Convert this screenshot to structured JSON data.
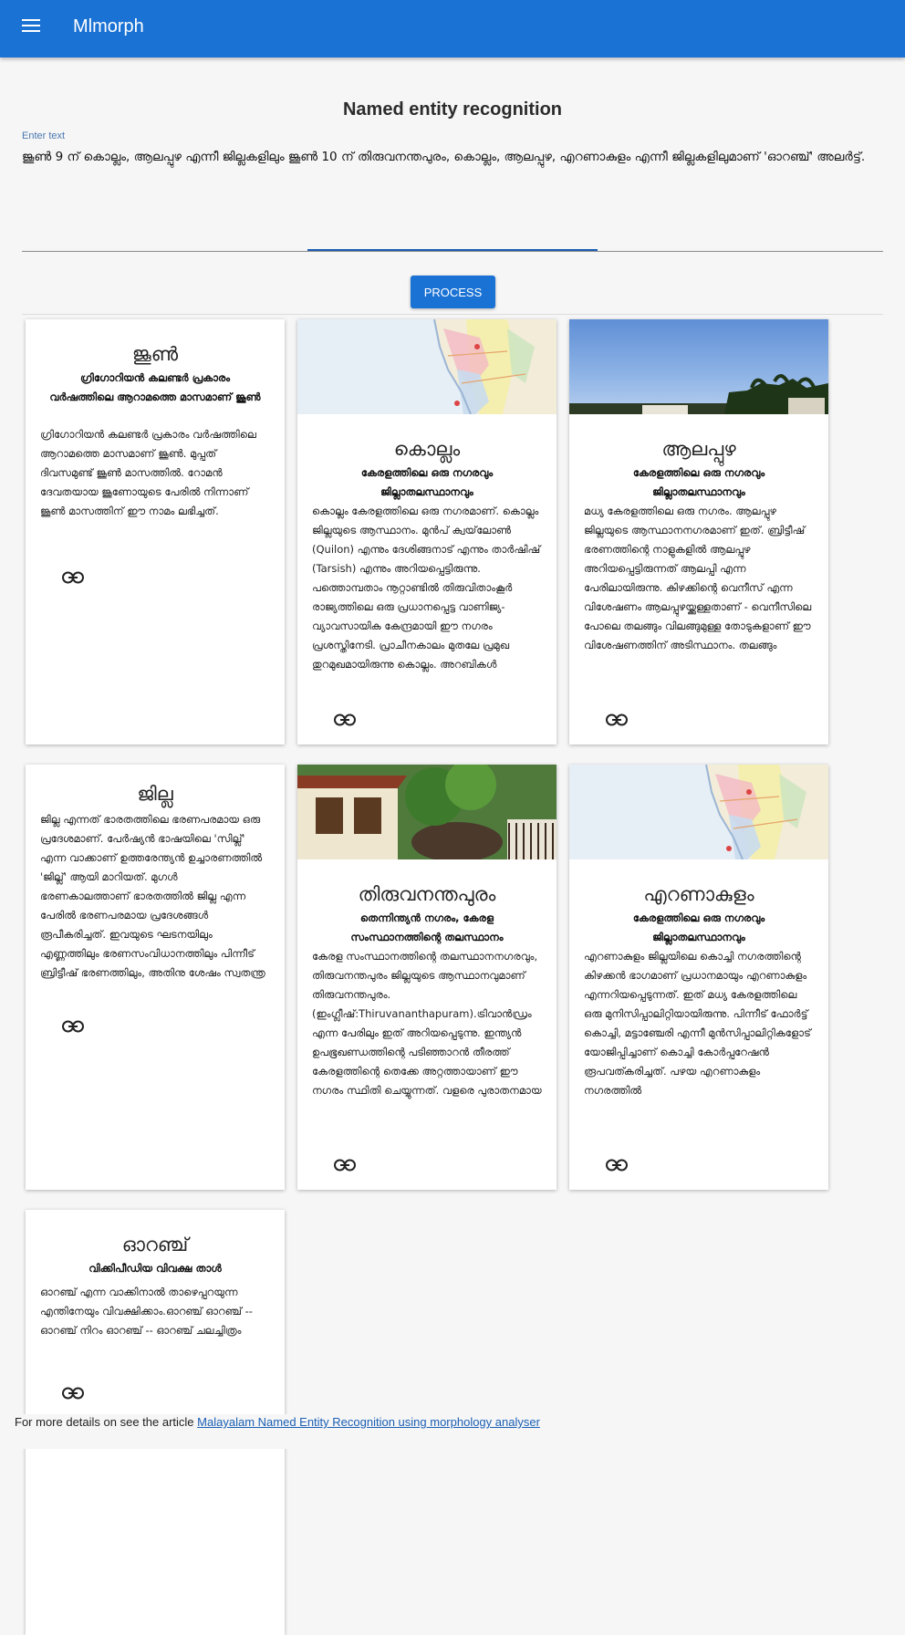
{
  "app": {
    "title": "Mlmorph"
  },
  "page": {
    "title": "Named entity recognition"
  },
  "input": {
    "label": "Enter text",
    "value": "ജൂൺ 9 ന് കൊല്ലം, ആലപ്പുഴ എന്നീ ജില്ലകളിലും ജൂൺ 10 ന് തിരുവനന്തപുരം, കൊല്ലം, ആലപ്പുഴ, എറണാകുളം എന്നീ ജില്ലകളിലുമാണ് 'ഓറഞ്ച്' അലർട്ട്."
  },
  "process_button": {
    "label": "PROCESS"
  },
  "cards": [
    {
      "word": "ജൂൺ",
      "subtitle": "ഗ്രിഗോറിയൻ കലണ്ടർ പ്രകാരം വർഷത്തിലെ ആറാമത്തെ മാസമാണ് ജൂൺ",
      "body": "ഗ്രിഗോറിയൻ കലണ്ടർ പ്രകാരം വർഷത്തിലെ ആറാമത്തെ മാസമാണ് ജൂൺ. മുപ്പത് ദിവസമുണ്ട് ജൂൺ മാസത്തിൽ. റോമൻ ദേവതയായ ജൂണോയുടെ പേരിൽ നിന്നാണ് ജൂൺ മാസത്തിന് ഈ നാമം ലഭിച്ചത്.",
      "link_icon": "link-icon"
    },
    {
      "word": "കൊല്ലം",
      "subtitle": "കേരളത്തിലെ ഒരു നഗരവും ജില്ലാതലസ്ഥാനവും",
      "body": "കൊല്ലം കേരളത്തിലെ ഒരു നഗരമാണ്. കൊല്ലം ജില്ലയുടെ ആസ്ഥാനം. മുൻപ് ക്വയ്‌ലോൺ (Quilon) എന്നും ദേശിങ്ങനാട് എന്നും താർഷിഷ് (Tarsish) എന്നും അറിയപ്പെട്ടിരുന്നു. പത്തൊമ്പതാം നൂറ്റാണ്ടിൽ തിരുവിതാംകൂർ രാജ്യത്തിലെ ഒരു പ്രധാനപ്പെട്ട വാണിജ്യ-വ്യാവസായിക കേന്ദ്രമായി ഈ നഗരം പ്രശസ്തിനേടി. പ്രാചീനകാലം മുതലേ പ്രമുഖ തുറമുഖമായിരുന്നു കൊല്ലം. അറബികൾ",
      "image": "map",
      "link_icon": "link-icon"
    },
    {
      "word": "ആലപ്പുഴ",
      "subtitle": "കേരളത്തിലെ ഒരു നഗരവും ജില്ലാതലസ്ഥാനവും",
      "body": "മധ്യ കേരളത്തിലെ ഒരു നഗരം. ആലപ്പുഴ ജില്ലയുടെ ആസ്ഥാനനഗരമാണ് ഇത്. ബ്രിട്ടീഷ് ഭരണത്തിന്റെ നാളുകളിൽ ആലപ്പുഴ അറിയപ്പെട്ടിരുന്നത് ആലപ്പി എന്ന പേരിലായിരുന്നു. കിഴക്കിന്റെ വെനീസ് എന്ന വിശേഷണം ആലപ്പുഴയ്ക്കുള്ളതാണ് - വെനീസിലെ പോലെ തലങ്ങും വിലങ്ങുമുള്ള തോടുകളാണ് ഈ വിശേഷണത്തിന് അടിസ്ഥാനം. തലങ്ങും",
      "image": "sky",
      "link_icon": "link-icon"
    },
    {
      "word": "ജില്ല",
      "subtitle": "",
      "body": "ജില്ല എന്നത് ഭാരതത്തിലെ ഭരണപരമായ ഒരു പ്രദേശമാണ്. പേർഷ്യൻ ഭാഷയിലെ 'സില്ല്' എന്ന വാക്കാണ് ഉത്തരേന്ത്യൻ ഉച്ചാരണത്തിൽ 'ജില്ല്' ആയി മാറിയത്. മുഗൾ ഭരണകാലത്താണ് ഭാരതത്തിൽ ജില്ല എന്ന പേരിൽ ഭരണപരമായ പ്രദേശങ്ങൾ രൂപീകരിച്ചത്. ഇവയുടെ ഘടനയിലും എണ്ണത്തിലും ഭരണസംവിധാനത്തിലും പിന്നീട് ബ്രിട്ടീഷ് ഭരണത്തിലും, അതിനു ശേഷം സ്വതന്ത്ര",
      "link_icon": "link-icon"
    },
    {
      "word": "തിരുവനന്തപുരം",
      "subtitle": "തെന്നിന്ത്യൻ നഗരം, കേരള സംസ്ഥാനത്തിന്റെ തലസ്ഥാനം",
      "body": "കേരള സംസ്ഥാനത്തിന്റെ തലസ്ഥാനനഗരവും, തിരുവനന്തപുരം ജില്ലയുടെ ആസ്ഥാനവുമാണ് തിരുവനന്തപുരം. (ഇംഗ്ലീഷ്:Thiruvananthapuram).ട്രിവാൻഡ്രം എന്ന പേരിലും ഇത് അറിയപ്പെടുന്നു. ഇന്ത്യൻ ഉപഭൂഖണ്ഡത്തിന്റെ പടിഞ്ഞാറൻ തീരത്ത് കേരളത്തിന്റെ തെക്കേ അറ്റത്തായാണ് ഈ നഗരം സ്ഥിതി ചെയ്യുന്നത്. വളരെ പുരാതനമായ",
      "image": "house",
      "link_icon": "link-icon"
    },
    {
      "word": "എറണാകുളം",
      "subtitle": "കേരളത്തിലെ ഒരു നഗരവും ജില്ലാതലസ്ഥാനവും",
      "body": "എറണാകുളം ജില്ലയിലെ കൊച്ചി നഗരത്തിന്റെ കിഴക്കൻ ഭാഗമാണ് പ്രധാനമായും എറണാകുളം എന്നറിയപ്പെടുന്നത്. ഇത് മധ്യ കേരളത്തിലെ ഒരു മുനിസിപ്പാലിറ്റിയായിരുന്നു. പിന്നീട് ഫോർട്ട് കൊച്ചി, മട്ടാഞ്ചേരി എന്നീ മുൻസിപ്പാലിറ്റികളോട് യോജിപ്പിച്ചാണ് കൊച്ചി കോർപ്പറേഷൻ രൂപവത്കരിച്ചത്. പഴയ എറണാകുളം നഗരത്തിൽ",
      "image": "map",
      "link_icon": "link-icon"
    },
    {
      "word": "ഓറഞ്ച്",
      "subtitle": "വിക്കിപീഡിയ വിവക്ഷ താൾ",
      "body": "ഓറഞ്ച് എന്ന വാക്കിനാൽ താഴെപ്പറയുന്ന എന്തിനേയും വിവക്ഷിക്കാം.ഓറഞ്ച് ഓറഞ്ച് -- ഓറഞ്ച് നിറം ഓറഞ്ച് -- ഓറഞ്ച് ചലച്ചിത്രം",
      "link_icon": "link-icon"
    }
  ],
  "footer": {
    "text": "For more details on see the article",
    "link_text": "Malayalam Named Entity Recognition using morphology analyser"
  }
}
